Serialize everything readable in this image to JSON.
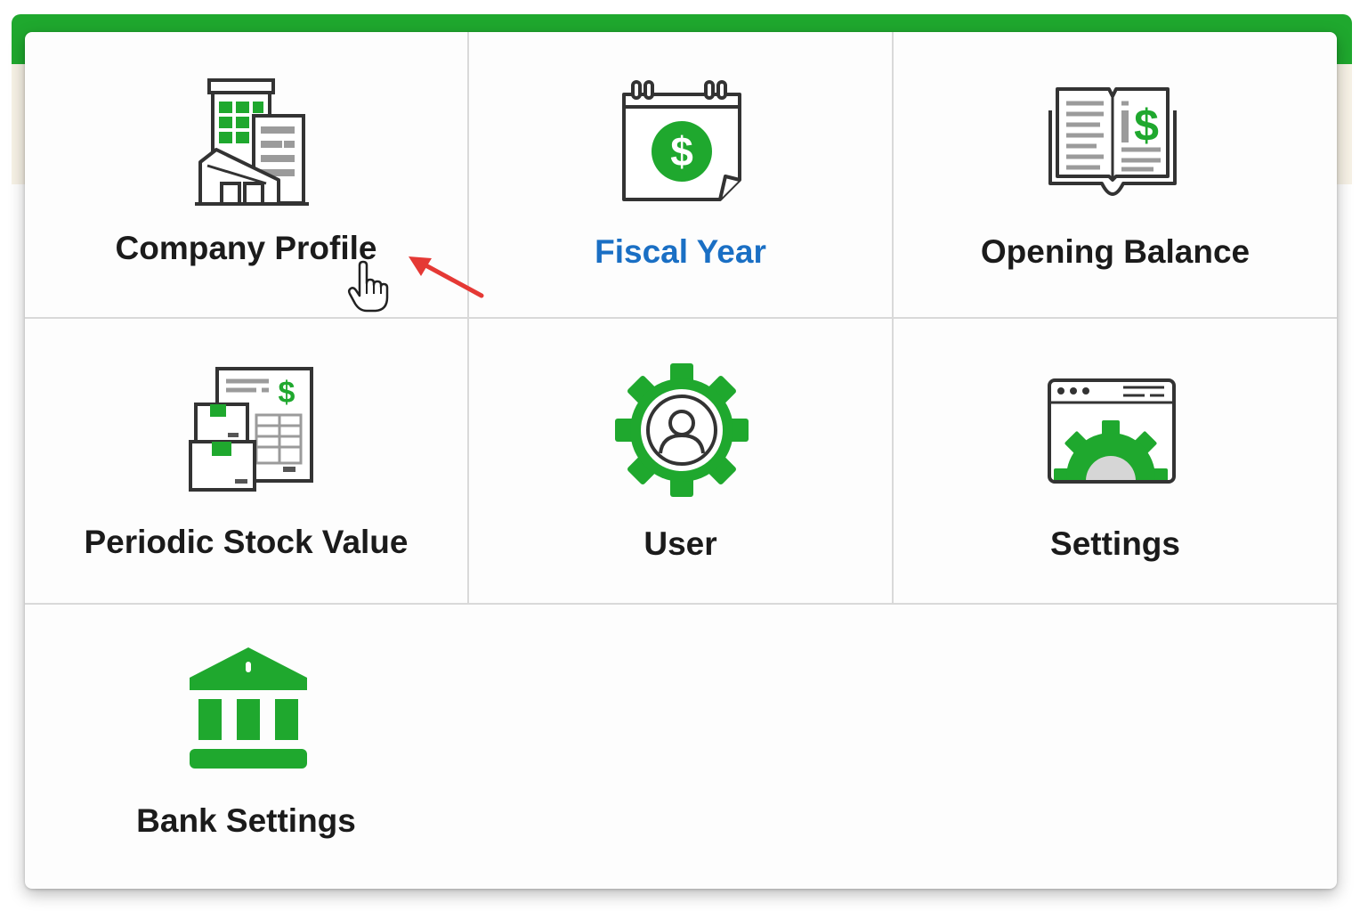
{
  "colors": {
    "brand_green": "#1fa82e",
    "active_label": "#1a6fc4",
    "label_text": "#1b1b1b",
    "icon_outline": "#333333",
    "annotation_arrow": "#e53935"
  },
  "menu": {
    "items": [
      {
        "label": "Company Profile",
        "icon": "company-building-icon",
        "active": false
      },
      {
        "label": "Fiscal Year",
        "icon": "calendar-dollar-icon",
        "active": true
      },
      {
        "label": "Opening Balance",
        "icon": "ledger-book-icon",
        "active": false
      },
      {
        "label": "Periodic Stock Value",
        "icon": "stock-invoice-boxes-icon",
        "active": false
      },
      {
        "label": "User",
        "icon": "user-gear-icon",
        "active": false
      },
      {
        "label": "Settings",
        "icon": "window-gear-icon",
        "active": false
      },
      {
        "label": "Bank Settings",
        "icon": "bank-icon",
        "active": false
      }
    ]
  },
  "overlay": {
    "cursor_icon": "hand-pointer-icon",
    "annotation_icon": "red-arrow-icon"
  }
}
